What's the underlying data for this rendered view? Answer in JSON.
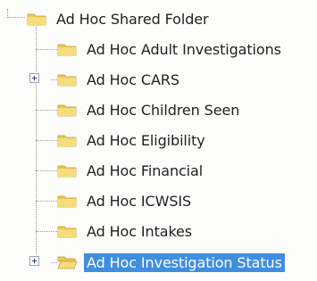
{
  "tree": {
    "root": {
      "label": "Ad Hoc Shared Folder",
      "icon": "folder-icon"
    },
    "items": [
      {
        "label": "Ad Hoc Adult Investigations",
        "icon": "folder-icon",
        "expandable": false,
        "selected": false
      },
      {
        "label": "Ad Hoc CARS",
        "icon": "folder-icon",
        "expandable": true,
        "expander": "+",
        "selected": false
      },
      {
        "label": "Ad Hoc Children Seen",
        "icon": "folder-icon",
        "expandable": false,
        "selected": false
      },
      {
        "label": "Ad Hoc Eligibility",
        "icon": "folder-icon",
        "expandable": false,
        "selected": false
      },
      {
        "label": "Ad Hoc Financial",
        "icon": "folder-icon",
        "expandable": false,
        "selected": false
      },
      {
        "label": "Ad Hoc ICWSIS",
        "icon": "folder-icon",
        "expandable": false,
        "selected": false
      },
      {
        "label": "Ad Hoc Intakes",
        "icon": "folder-icon",
        "expandable": false,
        "selected": false
      },
      {
        "label": "Ad Hoc Investigation Status",
        "icon": "open-folder-icon",
        "expandable": true,
        "expander": "+",
        "selected": true
      }
    ]
  },
  "colors": {
    "selection": "#3f8ee0",
    "folder": "#f2d36b",
    "folder_dark": "#d9b23c"
  }
}
